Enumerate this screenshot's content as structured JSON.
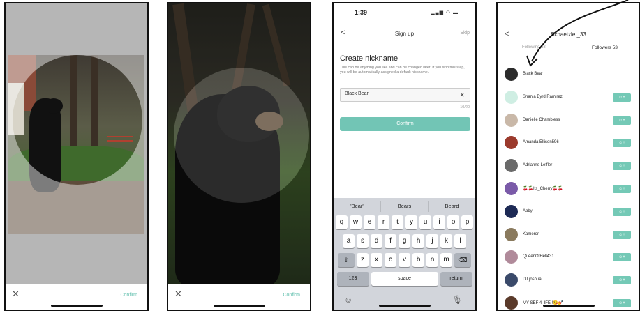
{
  "panel1": {
    "close_label": "✕",
    "confirm_label": "Confirm"
  },
  "panel2": {
    "close_label": "✕",
    "confirm_label": "Confirm"
  },
  "signup": {
    "time": "1:39",
    "status_icons": "signal wifi battery",
    "back_icon": "<",
    "nav_title": "Sign up",
    "skip_label": "Skip",
    "heading": "Create nickname",
    "description": "This can be anything you like and can be changed later. If you skip this step, you will be automatically assigned a default nickname.",
    "nickname_value": "Black Bear",
    "clear_icon": "✕",
    "counter": "10/20",
    "confirm_label": "Confirm",
    "suggestions": [
      "\"Bear\"",
      "Bears",
      "Beard"
    ],
    "keys_row1": [
      "q",
      "w",
      "e",
      "r",
      "t",
      "y",
      "u",
      "i",
      "o",
      "p"
    ],
    "keys_row2": [
      "a",
      "s",
      "d",
      "f",
      "g",
      "h",
      "j",
      "k",
      "l"
    ],
    "keys_row3": [
      "z",
      "x",
      "c",
      "v",
      "b",
      "n",
      "m"
    ],
    "key_123": "123",
    "key_space": "space",
    "key_return": "return",
    "shift_icon": "⇧",
    "delete_icon": "⌫",
    "emoji_icon": "☺",
    "mic_icon": "🎙"
  },
  "followers": {
    "back_icon": "<",
    "title": "Schaetzle _33",
    "tab_following": "Following 68",
    "tab_followers": "Followers 53",
    "add_icon": "☺+",
    "items": [
      {
        "name": "Black Bear",
        "avatar_color": "#2b2b2b",
        "has_button": false
      },
      {
        "name": "Shania Byrd Ramirez",
        "avatar_color": "#cfeee3",
        "has_button": true
      },
      {
        "name": "Danielle Chambless",
        "avatar_color": "#c9b8a8",
        "has_button": true
      },
      {
        "name": "Amanda Ellison596",
        "avatar_color": "#9b3a2c",
        "has_button": true
      },
      {
        "name": "Adrianne Leffler",
        "avatar_color": "#6a6a6a",
        "has_button": true
      },
      {
        "name": "🍒🍒Its_Cherry🍒🍒",
        "avatar_color": "#7a5aa8",
        "has_button": true
      },
      {
        "name": "Abby",
        "avatar_color": "#1d2a55",
        "has_button": true
      },
      {
        "name": "Kameron",
        "avatar_color": "#8a7a5e",
        "has_button": true
      },
      {
        "name": "QueenOfHell431",
        "avatar_color": "#b08a9a",
        "has_button": true
      },
      {
        "name": "DJ joshua",
        "avatar_color": "#3a4a6a",
        "has_button": true
      },
      {
        "name": "MY SEF 4_IFE!!😘💅",
        "avatar_color": "#5a3a2a",
        "has_button": true
      }
    ]
  }
}
